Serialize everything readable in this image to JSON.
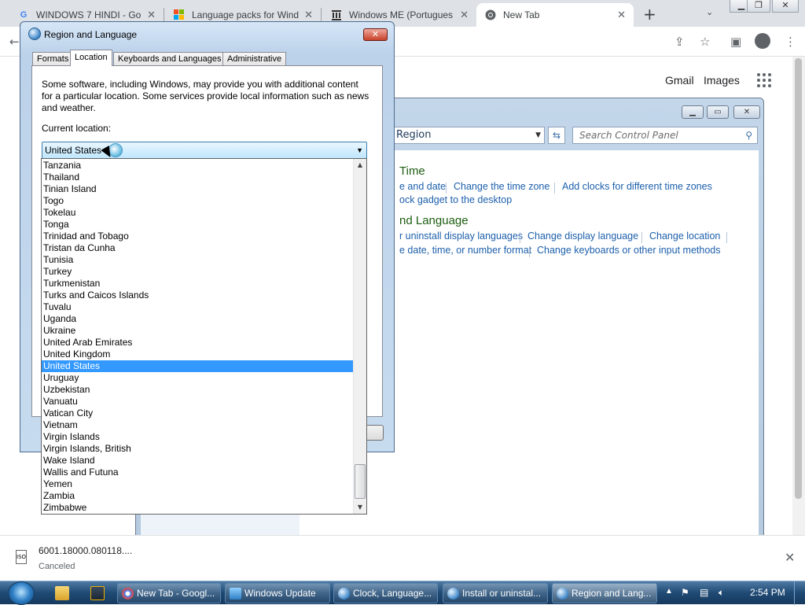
{
  "browser": {
    "tabs": [
      {
        "title": "WINDOWS 7 HINDI - Go",
        "favicon": "google-icon"
      },
      {
        "title": "Language packs for Wind",
        "favicon": "microsoft-icon"
      },
      {
        "title": "Windows ME (Portugues",
        "favicon": "archive-icon"
      },
      {
        "title": "New Tab",
        "favicon": "chrome-icon"
      }
    ],
    "google_links": {
      "gmail": "Gmail",
      "images": "Images"
    }
  },
  "control_panel": {
    "address": "Region",
    "search_placeholder": "Search Control Panel",
    "sections": [
      {
        "heading": "Time",
        "links": [
          "e and date",
          "Change the time zone",
          "Add clocks for different time zones",
          "ock gadget to the desktop"
        ]
      },
      {
        "heading": "nd Language",
        "links": [
          "r uninstall display languages",
          "Change display language",
          "Change location",
          "e date, time, or number format",
          "Change keyboards or other input methods"
        ]
      }
    ]
  },
  "dialog": {
    "title": "Region and Language",
    "tabs": [
      "Formats",
      "Location",
      "Keyboards and Languages",
      "Administrative"
    ],
    "description": "Some software, including Windows, may provide you with additional content for a particular location. Some services provide local information such as news and weather.",
    "current_location_label": "Current location:",
    "selected_location": "United States",
    "locations": [
      "Tanzania",
      "Thailand",
      "Tinian Island",
      "Togo",
      "Tokelau",
      "Tonga",
      "Trinidad and Tobago",
      "Tristan da Cunha",
      "Tunisia",
      "Turkey",
      "Turkmenistan",
      "Turks and Caicos Islands",
      "Tuvalu",
      "Uganda",
      "Ukraine",
      "United Arab Emirates",
      "United Kingdom",
      "United States",
      "Uruguay",
      "Uzbekistan",
      "Vanuatu",
      "Vatican City",
      "Vietnam",
      "Virgin Islands",
      "Virgin Islands, British",
      "Wake Island",
      "Wallis and Futuna",
      "Yemen",
      "Zambia",
      "Zimbabwe"
    ]
  },
  "download": {
    "filename": "6001.18000.080118....",
    "status": "Canceled"
  },
  "taskbar": {
    "buttons": [
      {
        "label": "New Tab - Googl...",
        "icon": "chrome-icon"
      },
      {
        "label": "Windows Update",
        "icon": "windows-update-icon"
      },
      {
        "label": "Clock, Language...",
        "icon": "globe-icon"
      },
      {
        "label": "Install or uninstal...",
        "icon": "globe-icon"
      },
      {
        "label": "Region and Lang...",
        "icon": "globe-icon"
      }
    ],
    "clock": "2:54 PM"
  }
}
